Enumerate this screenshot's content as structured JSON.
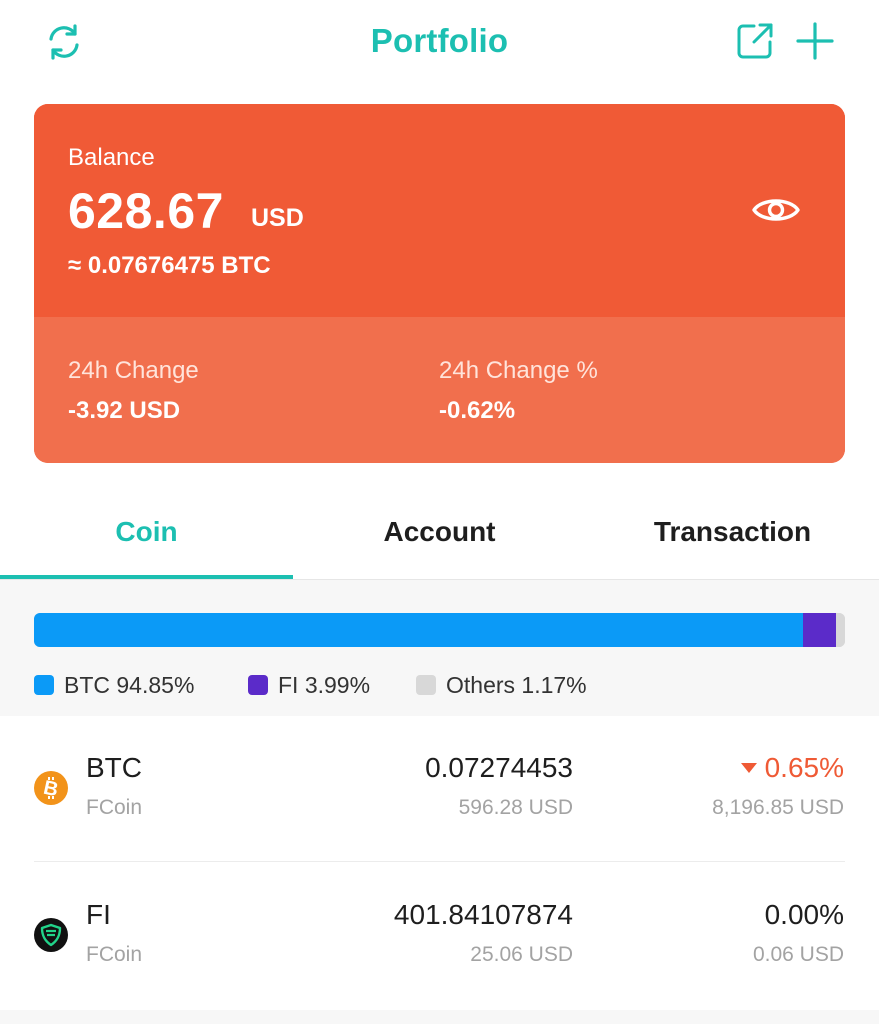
{
  "header": {
    "title": "Portfolio",
    "icons": {
      "left": "refresh-icon",
      "share": "share-external-icon",
      "add": "plus-icon"
    },
    "accent_color": "#1cbfb1"
  },
  "balance_card": {
    "label": "Balance",
    "amount": "628.67",
    "currency": "USD",
    "btc_equivalent": "≈ 0.07676475 BTC",
    "visibility_icon": "eye-icon",
    "card_color": "#f05a36",
    "change_24h": {
      "label": "24h Change",
      "value": "-3.92 USD"
    },
    "change_24h_pct": {
      "label": "24h Change %",
      "value": "-0.62%"
    }
  },
  "tabs": [
    {
      "label": "Coin",
      "active": true
    },
    {
      "label": "Account",
      "active": false
    },
    {
      "label": "Transaction",
      "active": false
    }
  ],
  "allocation": {
    "segments": [
      {
        "name": "BTC",
        "percent": 94.85,
        "color": "#0b9af7"
      },
      {
        "name": "FI",
        "percent": 3.99,
        "color": "#5b2bc9"
      },
      {
        "name": "Others",
        "percent": 1.17,
        "color": "#d8d8d8"
      }
    ],
    "legend": [
      "BTC 94.85%",
      "FI 3.99%",
      "Others 1.17%"
    ]
  },
  "coins": [
    {
      "symbol": "BTC",
      "source": "FCoin",
      "quantity": "0.07274453",
      "value_usd": "596.28 USD",
      "change": "0.65%",
      "change_direction": "down",
      "change_color": "#ef5a35",
      "price": "8,196.85 USD",
      "icon": "bitcoin-icon"
    },
    {
      "symbol": "FI",
      "source": "FCoin",
      "quantity": "401.84107874",
      "value_usd": "25.06 USD",
      "change": "0.00%",
      "change_direction": "flat",
      "change_color": "#1e1e1e",
      "price": "0.06 USD",
      "icon": "fi-shield-icon"
    }
  ]
}
